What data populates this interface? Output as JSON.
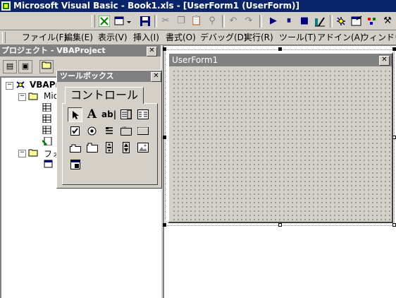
{
  "window": {
    "title": "Microsoft Visual Basic - Book1.xls - [UserForm1 (UserForm)]"
  },
  "toolbar": {
    "icons": [
      "excel-view-icon",
      "insert-userform-icon",
      "save-icon",
      "cut-icon",
      "copy-icon",
      "paste-icon",
      "find-icon",
      "undo-icon",
      "redo-icon",
      "run-icon",
      "break-icon",
      "reset-icon",
      "design-mode-icon",
      "project-explorer-icon",
      "properties-icon",
      "object-browser-icon",
      "toolbox-icon"
    ]
  },
  "menu": {
    "items": [
      "ファイル(F)",
      "編集(E)",
      "表示(V)",
      "挿入(I)",
      "書式(O)",
      "デバッグ(D)",
      "実行(R)",
      "ツール(T)",
      "アドイン(A)",
      "ウィンドウ(W)"
    ],
    "accel": [
      "F",
      "E",
      "V",
      "I",
      "O",
      "D",
      "R",
      "T",
      "A",
      "W"
    ]
  },
  "project": {
    "title": "プロジェクト - VBAProject",
    "tree": {
      "root": "VBAPr",
      "folder1": "Micr",
      "folder2": "フォ"
    }
  },
  "userform": {
    "title": "UserForm1"
  },
  "toolbox": {
    "title": "ツールボックス",
    "tab": "コントロール",
    "tools": [
      "select-objects",
      "label",
      "textbox",
      "combobox",
      "listbox",
      "checkbox",
      "optionbutton",
      "togglebutton",
      "frame",
      "commandbutton",
      "tabstrip",
      "multipage",
      "scrollbar",
      "spinbutton",
      "image",
      "refedit"
    ],
    "label_glyph": "A",
    "textbox_glyph": "ab|"
  },
  "colors": {
    "titlebar": "#0a246a",
    "face": "#d4d0c8",
    "inactive_title": "#808080"
  }
}
